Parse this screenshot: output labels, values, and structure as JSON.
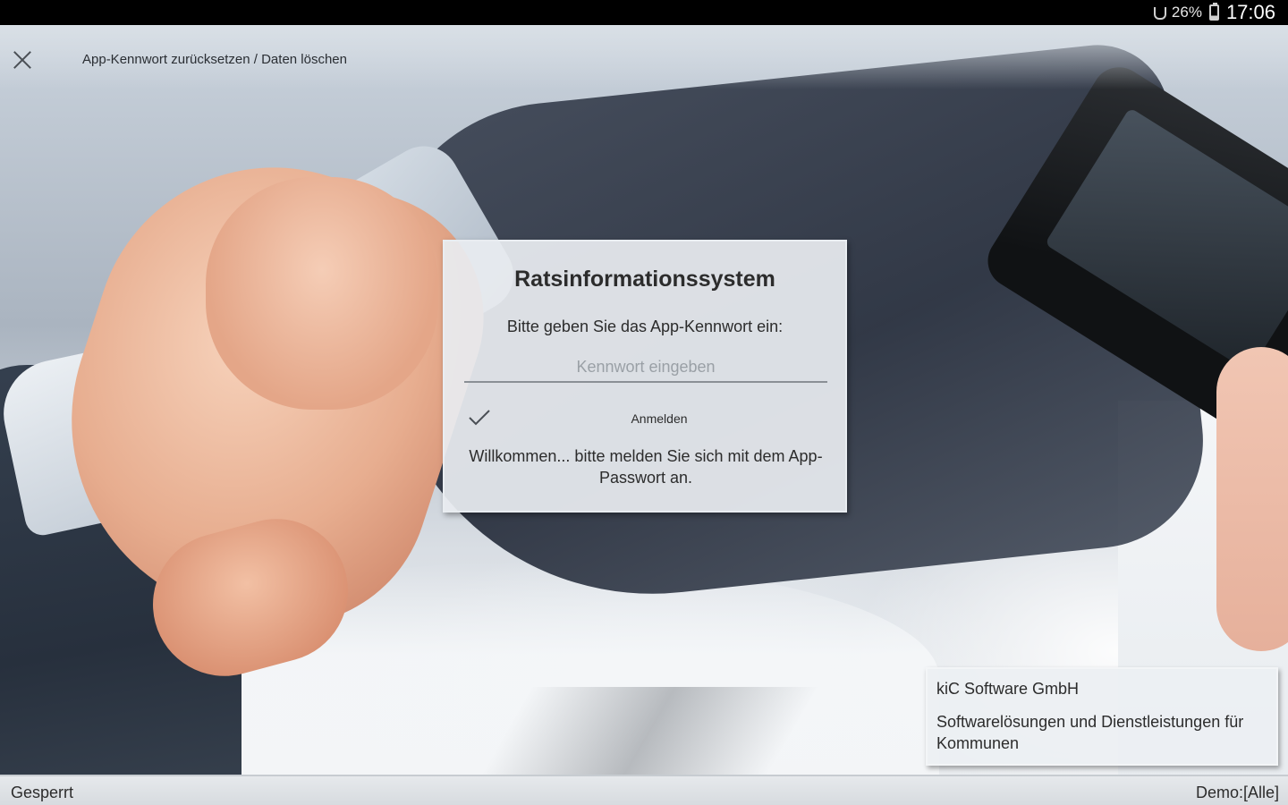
{
  "status_bar": {
    "battery_percent": "26%",
    "time": "17:06"
  },
  "top_bar": {
    "reset_link": "App-Kennwort zurücksetzen / Daten löschen"
  },
  "dialog": {
    "title": "Ratsinformationssystem",
    "prompt": "Bitte geben Sie das App-Kennwort ein:",
    "password_placeholder": "Kennwort eingeben",
    "password_value": "",
    "login_label": "Anmelden",
    "welcome": "Willkommen... bitte melden Sie sich mit dem App-Passwort an."
  },
  "company": {
    "name": "kiC Software GmbH",
    "description": "Softwarelösungen und Dienstleistungen für Kommunen"
  },
  "bottom_bar": {
    "status": "Gesperrt",
    "demo": "Demo:[Alle]"
  }
}
